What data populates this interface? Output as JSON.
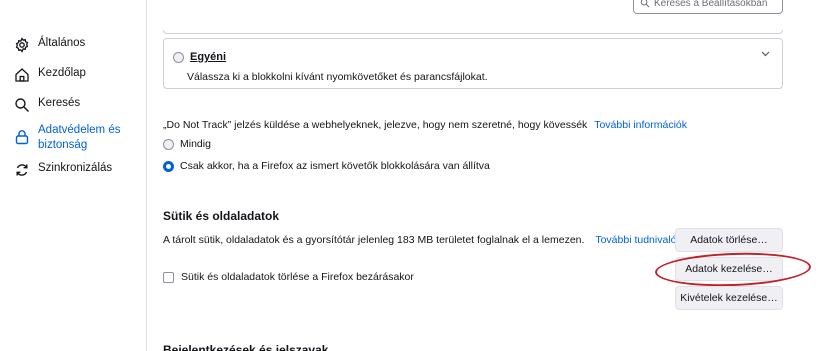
{
  "sidebar": {
    "items": [
      {
        "icon": "gear-icon",
        "label": "Általános"
      },
      {
        "icon": "home-icon",
        "label": "Kezdőlap"
      },
      {
        "icon": "search-icon",
        "label": "Keresés"
      },
      {
        "icon": "lock-icon",
        "label_line1": "Adatvédelem és",
        "label_line2": "biztonság",
        "selected": true
      },
      {
        "icon": "sync-icon",
        "label": "Szinkronizálás"
      }
    ]
  },
  "search": {
    "placeholder": "Keresés a Beállításokban"
  },
  "tracking": {
    "custom_title": "Egyéni",
    "custom_desc": "Válassza ki a blokkolni kívánt nyomkövetőket és parancsfájlokat.",
    "dnt_text": "„Do Not Track” jelzés küldése a webhelyeknek, jelezve, hogy nem szeretné, hogy kövessék",
    "dnt_link": "További információk",
    "dnt_always": "Mindig",
    "dnt_only_when": "Csak akkor, ha a Firefox az ismert követők blokkolására van állítva"
  },
  "cookies": {
    "title": "Sütik és oldaladatok",
    "usage_text": "A tárolt sütik, oldaladatok és a gyorsítótár jelenleg 183 MB területet foglalnak el a lemezen.",
    "usage_link": "További tudnivalók",
    "delete_on_close": "Sütik és oldaladatok törlése a Firefox bezárásakor",
    "btn_clear": "Adatok törlése…",
    "btn_manage": "Adatok kezelése…",
    "btn_exceptions": "Kivételek kezelése…"
  },
  "next_section": {
    "title": "Bejelentkezések és jelszavak"
  },
  "colors": {
    "accent": "#0061e0",
    "highlight": "#c0202a"
  }
}
